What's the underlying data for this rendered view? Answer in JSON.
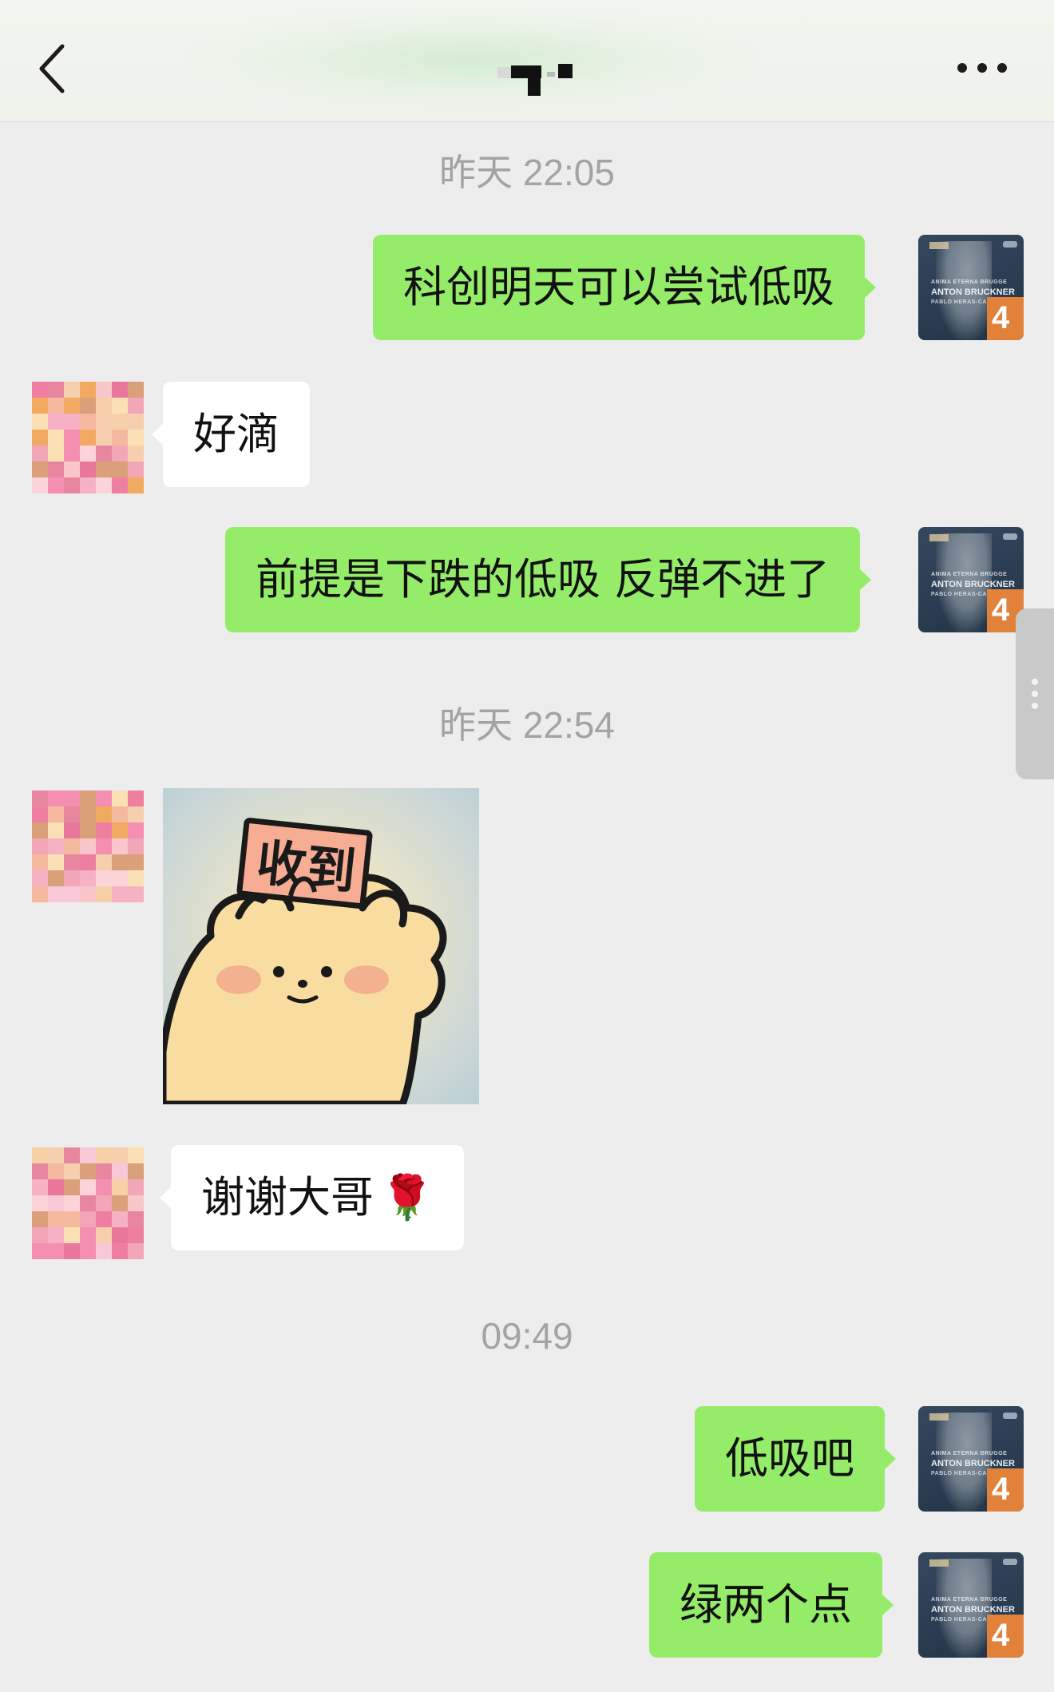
{
  "header": {
    "title": "",
    "back_icon": "chevron-left-icon",
    "more_icon": "more-horizontal-icon",
    "background_color": "#f0f3ee"
  },
  "colors": {
    "chat_background": "#ededed",
    "my_bubble": "#95ec69",
    "other_bubble": "#ffffff",
    "timestamp_text": "#a3a3a3"
  },
  "timestamps": {
    "t1": "昨天 22:05",
    "t2": "昨天 22:54",
    "t3": "09:49"
  },
  "messages": {
    "m1": {
      "sender": "me",
      "text": "科创明天可以尝试低吸"
    },
    "m2": {
      "sender": "other",
      "text": "好滴"
    },
    "m3": {
      "sender": "me",
      "text": "前提是下跌的低吸 反弹不进了"
    },
    "m4": {
      "sender": "other",
      "sticker_text": "收到"
    },
    "m5": {
      "sender": "other",
      "text": "谢谢大哥",
      "emoji": "🌹"
    },
    "m6": {
      "sender": "me",
      "text": "低吸吧"
    },
    "m7": {
      "sender": "me",
      "text": "绿两个点"
    }
  },
  "my_avatar": {
    "line1": "ANIMA ETERNA BRUGGE",
    "line2": "ANTON BRUCKNER",
    "line3": "PABLO HERAS-CASADO",
    "number": "4"
  },
  "side_handle_icon": "drag-handle-icon"
}
